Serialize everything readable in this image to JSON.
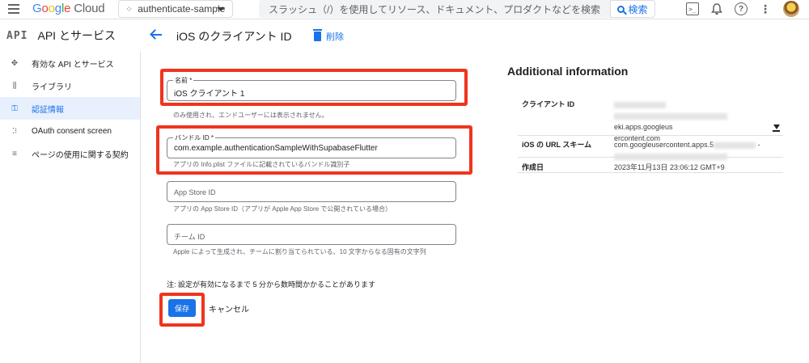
{
  "topbar": {
    "brand": "Google",
    "product": "Cloud",
    "project": "authenticate-sample",
    "search_placeholder": "スラッシュ（/）を使用してリソース、ドキュメント、プロダクトなどを検索",
    "search_button": "検索",
    "icons": [
      "menu-icon",
      "terminal-icon",
      "bell-icon",
      "help-icon",
      "more-vert-icon"
    ]
  },
  "apibar": {
    "logo": "API",
    "title": "API とサービス"
  },
  "page": {
    "title": "iOS のクライアント ID",
    "delete_label": "削除"
  },
  "sidebar": {
    "items": [
      {
        "label": "有効な API とサービス",
        "icon": "api-icon",
        "active": false
      },
      {
        "label": "ライブラリ",
        "icon": "library-icon",
        "active": false
      },
      {
        "label": "認証情報",
        "icon": "key-icon",
        "active": true
      },
      {
        "label": "OAuth consent screen",
        "icon": "consent-icon",
        "active": false
      },
      {
        "label": "ページの使用に関する契約",
        "icon": "settings-icon",
        "active": false
      }
    ]
  },
  "form": {
    "name_label": "名前 *",
    "name_value": "iOS クライアント 1",
    "name_hint": "のみ使用され、エンドユーザーには表示されません。",
    "bundle_label": "バンドル ID *",
    "bundle_value": "com.example.authenticationSampleWithSupabaseFlutter",
    "bundle_hint": "アプリの Info.plist ファイルに記載されているバンドル識別子",
    "appstore_placeholder": "App Store ID",
    "appstore_hint": "アプリの App Store ID（アプリが Apple App Store で公開されている場合）",
    "team_placeholder": "チーム ID",
    "team_hint": "Apple によって生成され、チームに割り当てられている、10 文字からなる固有の文字列",
    "note": "注: 設定が有効になるまで 5 分から数時間かかることがあります",
    "save": "保存",
    "cancel": "キャンセル"
  },
  "info": {
    "title": "Additional information",
    "client_id_key": "クライアント ID",
    "client_id_part1": "eki.apps.googleus",
    "client_id_part2": "ercontent.com",
    "url_scheme_key": "iOS の URL スキーム",
    "url_scheme_value": "com.googleusercontent.apps.5",
    "created_key": "作成日",
    "created_value": "2023年11月13日 23:06:12 GMT+9"
  },
  "colors": {
    "accent": "#1a73e8",
    "highlight_box": "#f0341e",
    "active_bg": "#e8f0fe"
  }
}
